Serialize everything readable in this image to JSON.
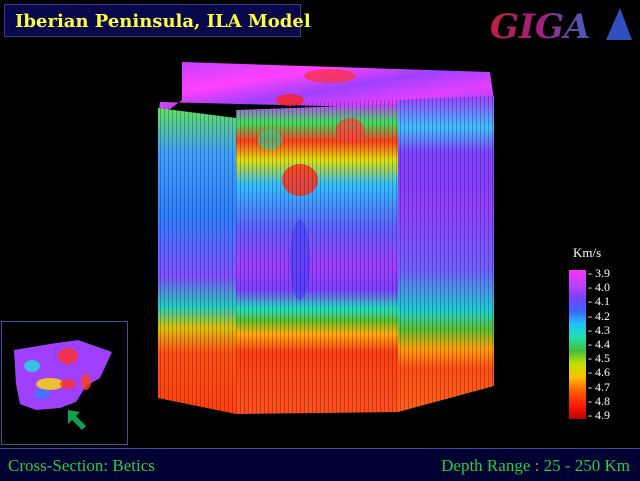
{
  "header": {
    "title": "Iberian Peninsula, ILA Model",
    "logo_text": "GIGA"
  },
  "legend": {
    "unit": "Km/s",
    "values": [
      "- 3.9",
      "- 4.0",
      "- 4.1",
      "- 4.2",
      "- 4.3",
      "- 4.4",
      "- 4.5",
      "- 4.6",
      "- 4.7",
      "- 4.8",
      "- 4.9"
    ]
  },
  "footer": {
    "cross_section": "Cross-Section: Betics",
    "depth_range": "Depth Range : 25 - 250 Km"
  },
  "colors": {
    "title": "#ffff40",
    "footer_text": "#20d040",
    "title_box": "#08084a",
    "footer_bg": "#000033"
  }
}
